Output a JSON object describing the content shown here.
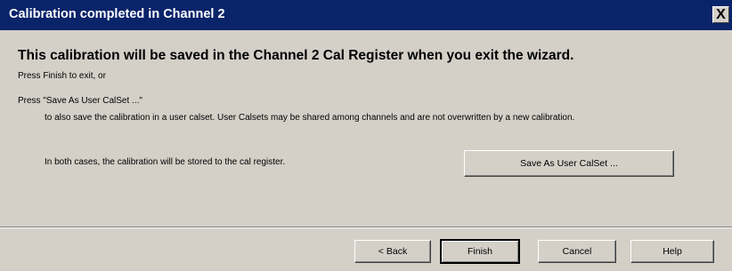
{
  "window": {
    "title": "Calibration completed in Channel 2",
    "close_glyph": "X"
  },
  "body": {
    "heading": "This calibration will be saved in the Channel 2 Cal Register when you exit the wizard.",
    "press_finish": "Press Finish to exit, or",
    "press_save": "Press \"Save As User CalSet ...\"",
    "description": "to also save the calibration in a user calset.  User Calsets may be shared among channels and are not overwritten by a new calibration.",
    "both_cases": "In both cases, the calibration will be stored to the cal register.",
    "save_button_label": "Save As User CalSet ..."
  },
  "footer": {
    "back_label": "< Back",
    "finish_label": "Finish",
    "cancel_label": "Cancel",
    "help_label": "Help"
  }
}
